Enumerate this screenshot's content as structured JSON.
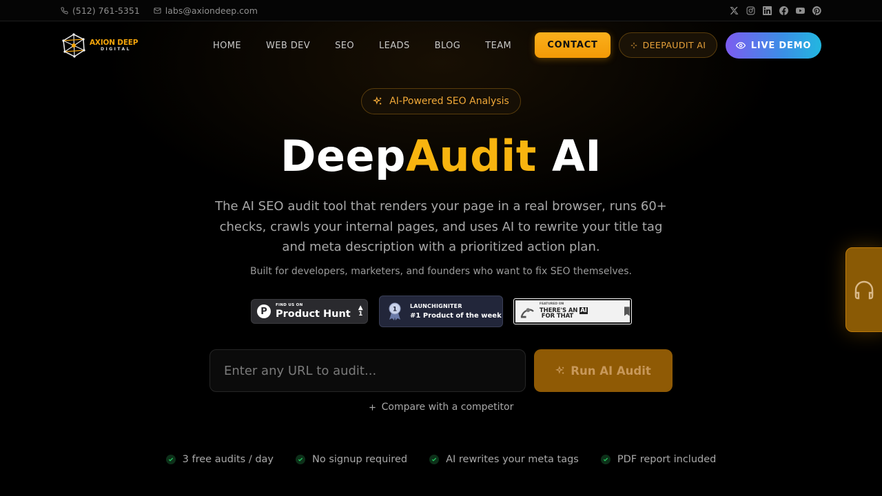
{
  "topbar": {
    "phone": "(512) 761-5351",
    "email": "labs@axiondeep.com",
    "socials": [
      "x-icon",
      "instagram-icon",
      "linkedin-icon",
      "facebook-icon",
      "youtube-icon",
      "pinterest-icon"
    ]
  },
  "nav": {
    "logo": {
      "line1": "AXION DEEP",
      "line2": "DIGITAL"
    },
    "links": [
      "HOME",
      "WEB DEV",
      "SEO",
      "LEADS",
      "BLOG",
      "TEAM"
    ],
    "contact_label": "CONTACT",
    "deepaudit_label": "DEEPAUDIT AI",
    "live_demo_label": "LIVE DEMO"
  },
  "hero": {
    "pill_label": "AI-Powered SEO Analysis",
    "title_part1": "Deep",
    "title_part2": "Audit",
    "title_part3": " AI",
    "description": "The AI SEO audit tool that renders your page in a real browser, runs 60+ checks, crawls your internal pages, and uses AI to rewrite your title tag and meta description with a prioritized action plan.",
    "subdescription": "Built for developers, marketers, and founders who want to fix SEO themselves."
  },
  "badges": {
    "product_hunt": {
      "small": "FIND US ON",
      "big": "Product Hunt",
      "votes": "1"
    },
    "launchigniter": {
      "small": "LAUNCHIGNITER",
      "big": "#1 Product of the week"
    },
    "aiforthat": {
      "small": "FEATURED ON",
      "big_a": "THERE'S AN ",
      "big_box": "AI",
      "big_b": " FOR THAT"
    }
  },
  "form": {
    "url_placeholder": "Enter any URL to audit...",
    "run_label": "Run AI Audit",
    "compare_label": "Compare with a competitor"
  },
  "features": [
    "3 free audits / day",
    "No signup required",
    "AI rewrites your meta tags",
    "PDF report included"
  ],
  "colors": {
    "accent": "#f8b40f",
    "contact_bg": "#f5a50a",
    "live_demo_gradient": [
      "#7c5cf0",
      "#22b7e0"
    ],
    "check_green": "#22c55e"
  }
}
